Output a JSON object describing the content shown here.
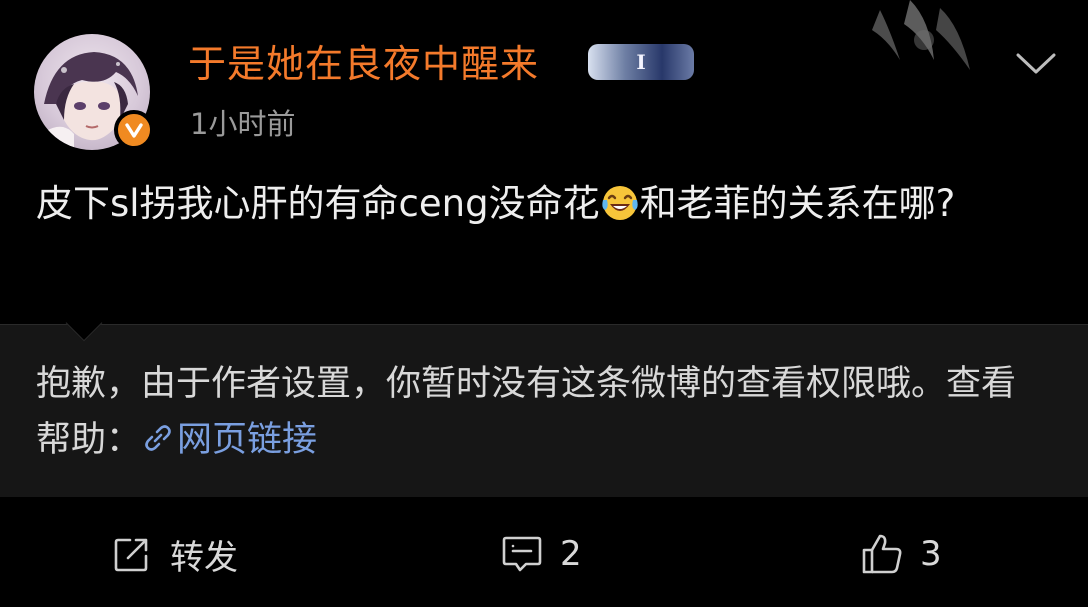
{
  "post": {
    "author": {
      "name": "于是她在良夜中醒来",
      "badge_text": "I",
      "verified": true,
      "verified_color": "#f08a21",
      "name_color": "#f47a2b"
    },
    "timestamp": "1小时前",
    "content": {
      "text_before_emoji": "皮下sl拐我心肝的有命ceng没命花",
      "emoji": "laugh-cry-emoji",
      "text_after_emoji": "和老菲的关系在哪?"
    },
    "notice": {
      "text": "抱歉，由于作者设置，你暂时没有这条微博的查看权限哦。查看帮助：",
      "link_label": "网页链接",
      "link_color": "#7a9fe0"
    },
    "actions": {
      "share": {
        "label": "转发",
        "icon": "share-icon"
      },
      "comment": {
        "count": "2",
        "icon": "comment-icon"
      },
      "like": {
        "count": "3",
        "icon": "thumbs-up-icon"
      }
    },
    "menu_icon": "chevron-down-icon",
    "theme": {
      "background": "#000000",
      "notice_background": "#161616"
    }
  }
}
